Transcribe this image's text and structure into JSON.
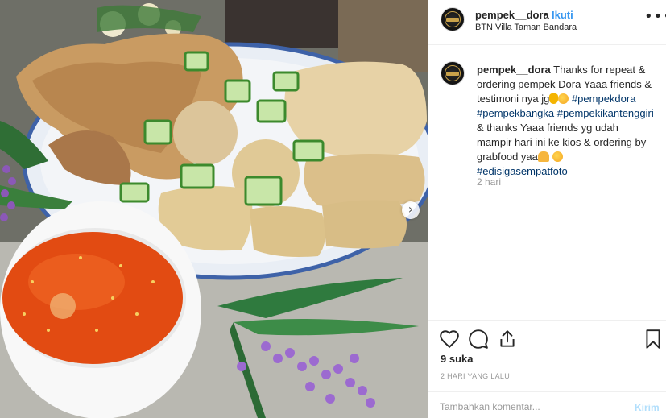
{
  "post": {
    "username": "pempek__dora",
    "separator": "•",
    "follow_label": "Ikuti",
    "location": "BTN Villa Taman Bandara",
    "more_icon": "more-options-icon",
    "caption": {
      "username": "pempek__dora",
      "text_1": " Thanks for repeat & ordering pempek Dora Yaaa friends & testimoni nya jg",
      "hashtag_1": "#pempekdora",
      "hashtag_2": "#pempekbangka",
      "hashtag_3": "#pempekikantenggiri",
      "text_2": " & thanks Yaaa friends yg udah mampir hari ini ke kios & ordering by grabfood yaa",
      "hashtag_4": "#edisigasempatfoto",
      "time": "2 hari"
    },
    "likes": "9 suka",
    "date_ago": "2 HARI YANG LALU",
    "comment_placeholder": "Tambahkan komentar...",
    "post_label": "Kirim",
    "icons": [
      "like-heart-icon",
      "comment-icon",
      "share-icon",
      "save-bookmark-icon"
    ],
    "colors": {
      "link_blue": "#3897f0",
      "hashtag_blue": "#003569",
      "muted": "#999999",
      "disabled_post": "#b2dffc"
    }
  }
}
